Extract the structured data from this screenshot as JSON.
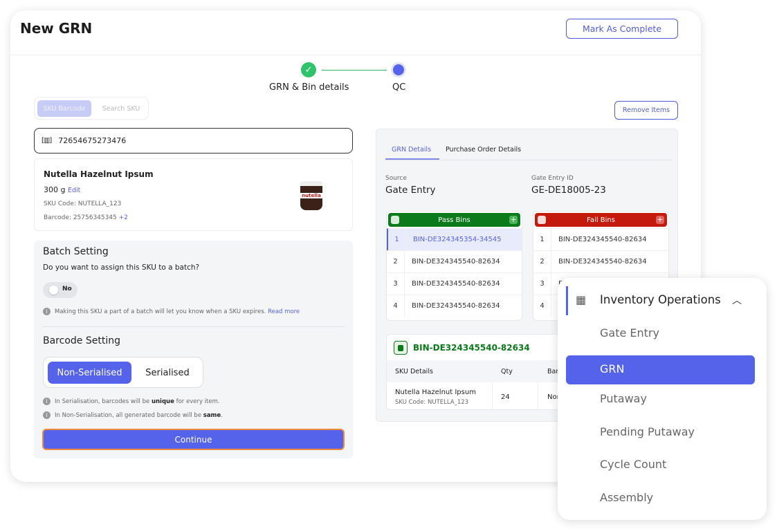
{
  "header": {
    "title": "New GRN",
    "mark_complete": "Mark As Complete"
  },
  "stepper": {
    "steps": [
      {
        "label": "GRN & Bin details",
        "status": "done"
      },
      {
        "label": "QC",
        "status": "active"
      }
    ]
  },
  "sku_tabs": {
    "tabs": [
      "SKU Barcode",
      "Search SKU"
    ],
    "active": "SKU Barcode"
  },
  "barcode_input": {
    "value": "72654675273476",
    "icon": "barcode-scan-icon"
  },
  "product": {
    "name": "Nutella Hazelnut Ipsum",
    "weight": "300 g",
    "edit": "Edit",
    "sku_code_label": "SKU Code:",
    "sku_code": "NUTELLA_123",
    "barcode_label": "Barcode:",
    "barcode": "25756345345",
    "barcode_more": "+2",
    "image_text": "nutella"
  },
  "batch": {
    "title": "Batch Setting",
    "question": "Do you want to assign this SKU to a batch?",
    "toggle_label": "No",
    "toggle_on": false,
    "info": "Making this SKU a part of a batch will let you know when a SKU expires.",
    "read_more": "Read more"
  },
  "barcode_setting": {
    "title": "Barcode Setting",
    "options": [
      "Non-Serialised",
      "Serialised"
    ],
    "selected": "Non-Serialised",
    "info1_pre": "In Serialisation, barcodes will be",
    "info1_bold": "unique",
    "info1_post": "for every item.",
    "info2_pre": "In Non-Serialisation, all generated barcode will be",
    "info2_bold": "same",
    "info2_post": "."
  },
  "continue": "Continue",
  "remove_items": "Remove Items",
  "details_tabs": {
    "tabs": [
      "GRN Details",
      "Purchase Order Details"
    ],
    "active": "GRN Details"
  },
  "source": {
    "label": "Source",
    "value": "Gate Entry"
  },
  "gate_entry": {
    "label": "Gate Entry ID",
    "value": "GE-DE18005-23"
  },
  "pass_bins": {
    "title": "Pass Bins",
    "color": "#0a7a1a",
    "rows": [
      {
        "n": "1",
        "bin": "BIN-DE324345354-34545"
      },
      {
        "n": "2",
        "bin": "BIN-DE324345540-82634"
      },
      {
        "n": "3",
        "bin": "BIN-DE324345540-82634"
      },
      {
        "n": "4",
        "bin": "BIN-DE324345540-82634"
      }
    ]
  },
  "fail_bins": {
    "title": "Fail Bins",
    "color": "#c41a0e",
    "rows": [
      {
        "n": "1",
        "bin": "BIN-DE324345540-82634"
      },
      {
        "n": "2",
        "bin": "BIN-DE324345540-82634"
      },
      {
        "n": "3",
        "bin": "F"
      },
      {
        "n": "4",
        "bin": ""
      }
    ]
  },
  "bin_detail": {
    "title": "BIN-DE324345540-82634",
    "columns": [
      "SKU Details",
      "Qty",
      "Barc"
    ],
    "row": {
      "name": "Nutella Hazelnut Ipsum",
      "sku": "SKU Code:  NUTELLA_123",
      "qty": "24",
      "barcode": "Nor"
    }
  },
  "menu": {
    "title": "Inventory Operations",
    "items": [
      "Gate Entry",
      "GRN",
      "Putaway",
      "Pending Putaway",
      "Cycle Count",
      "Assembly"
    ],
    "active": "GRN",
    "accent": "#5563ea"
  }
}
